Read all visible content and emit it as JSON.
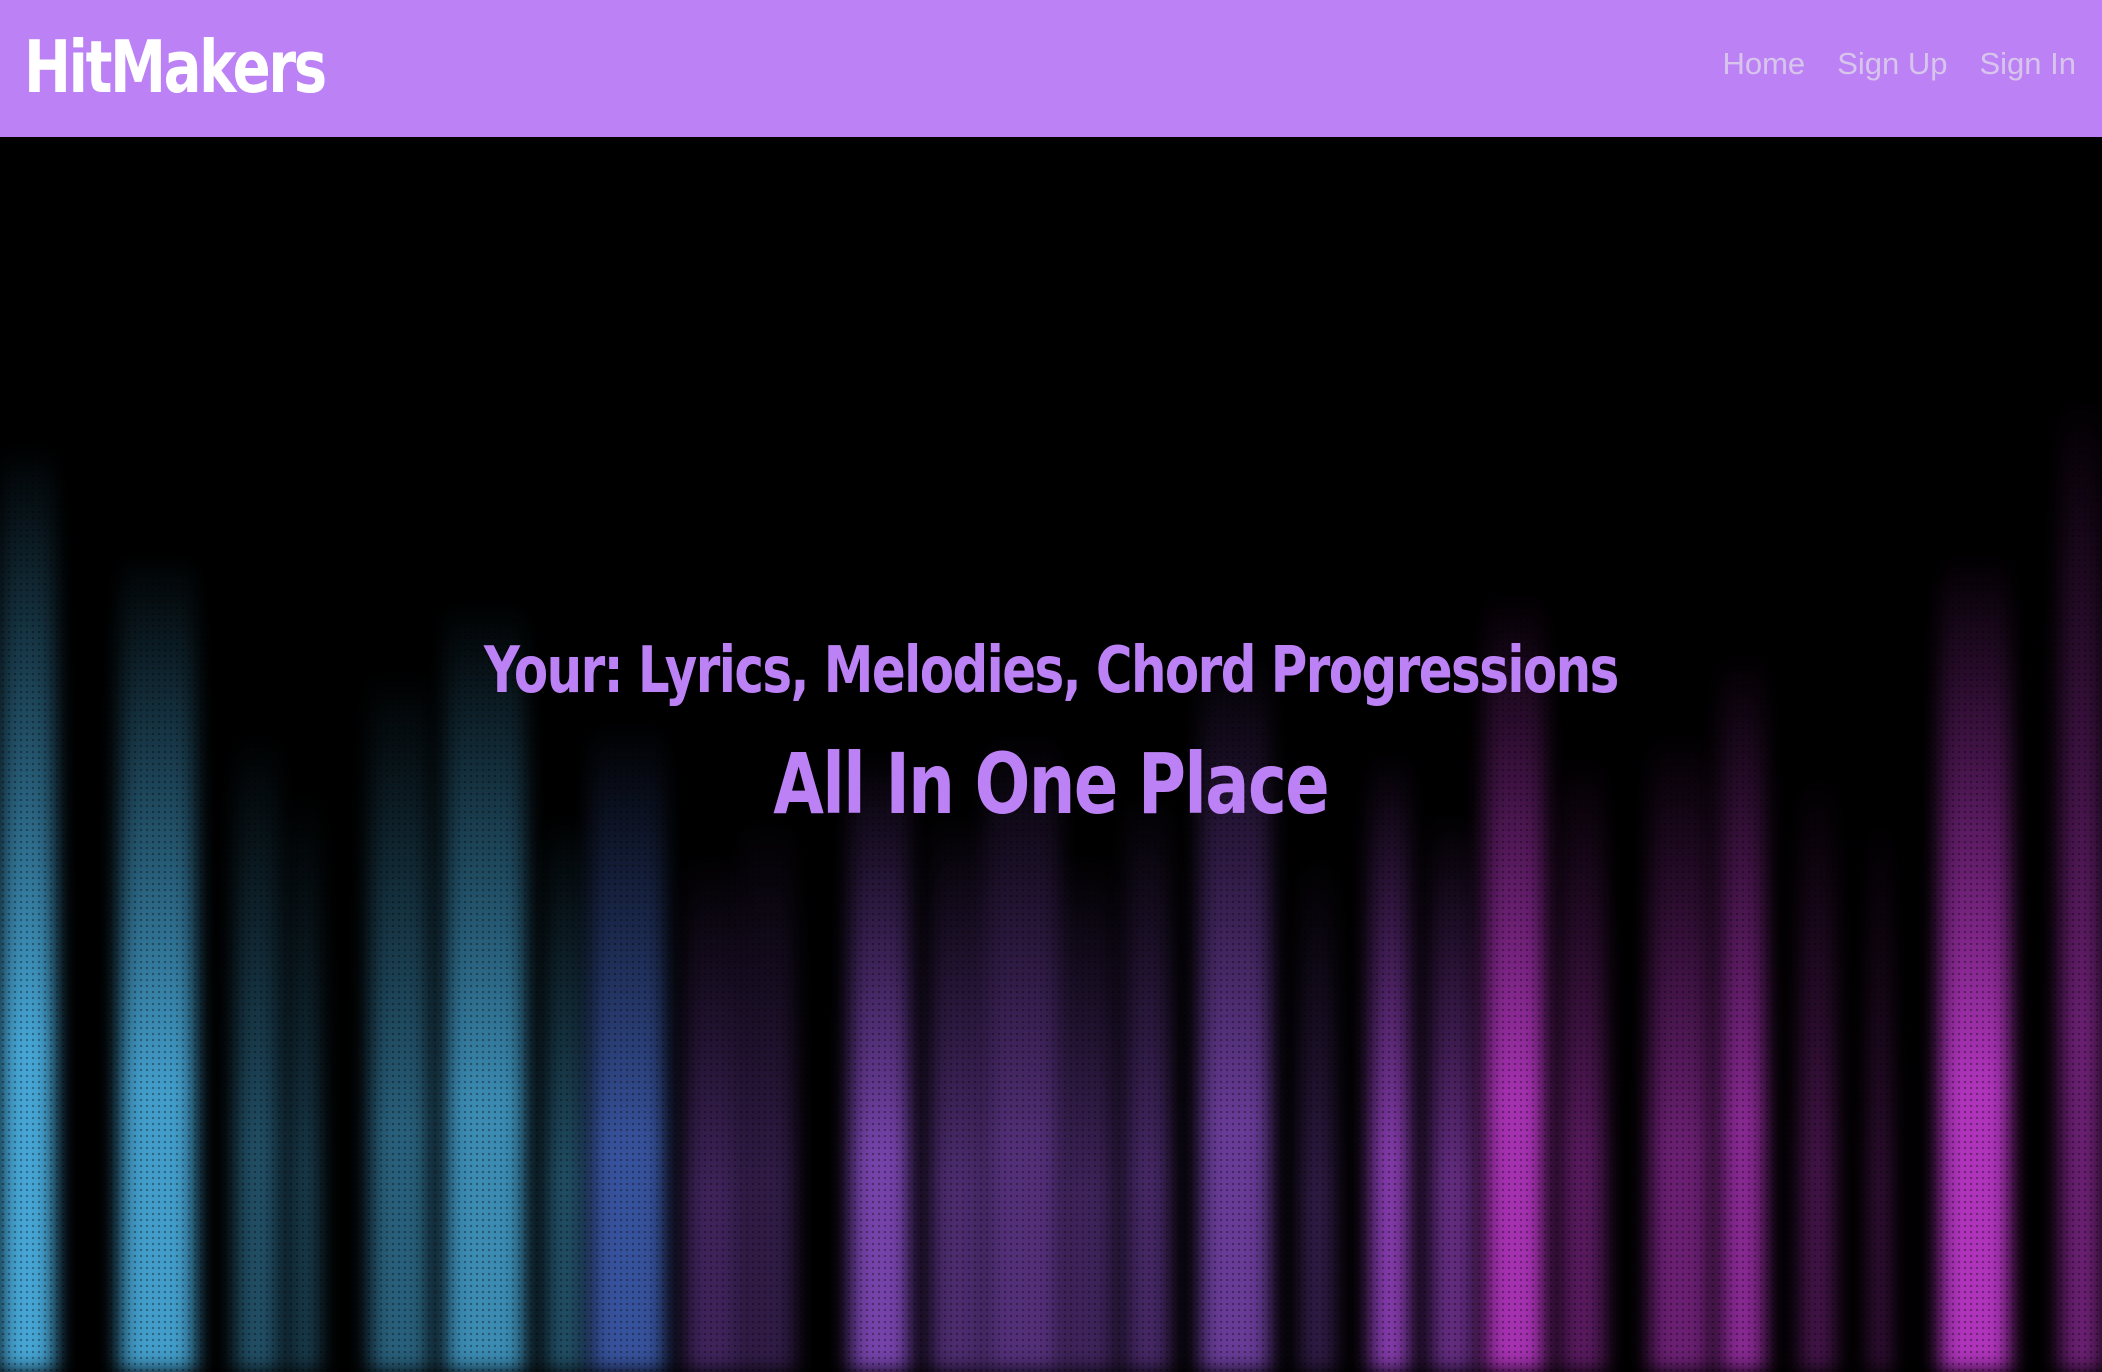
{
  "header": {
    "brand": "HitMakers",
    "nav": [
      {
        "label": "Home"
      },
      {
        "label": "Sign Up"
      },
      {
        "label": "Sign In"
      }
    ]
  },
  "hero": {
    "line1": "Your: Lyrics, Melodies, Chord Progressions",
    "line2": "All In One Place"
  },
  "colors": {
    "accent": "#bc82f5",
    "nav_text": "#d7c5ec",
    "background": "#000000",
    "bar_cyan": "#4aaee0",
    "bar_purple": "#8a4fc8",
    "bar_magenta": "#c23ad0"
  }
}
